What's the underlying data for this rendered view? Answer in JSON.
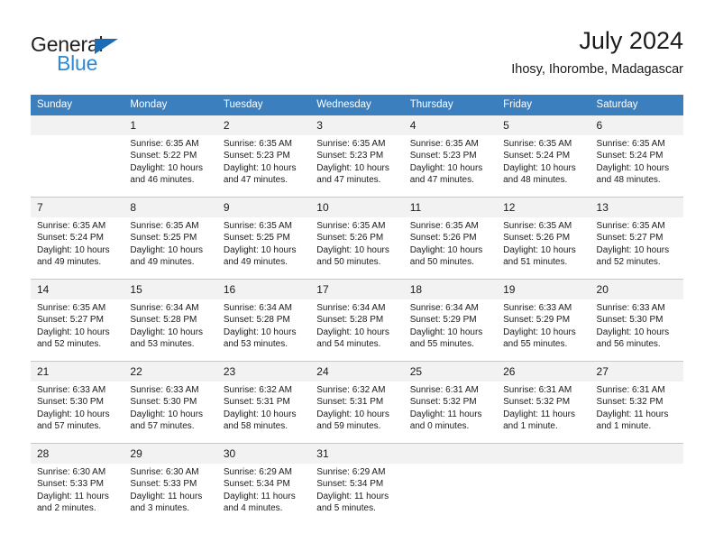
{
  "brand": {
    "name_part1": "General",
    "name_part2": "Blue",
    "accent_color": "#2e8ad4",
    "triangle_color": "#1b6cb5"
  },
  "header": {
    "title": "July 2024",
    "subtitle": "Ihosy, Ihorombe, Madagascar"
  },
  "calendar": {
    "header_color": "#3c7fbe",
    "daynum_band_color": "#f2f2f2",
    "weekday_headers": [
      "Sunday",
      "Monday",
      "Tuesday",
      "Wednesday",
      "Thursday",
      "Friday",
      "Saturday"
    ],
    "weeks": [
      [
        {
          "day": "",
          "sunrise": "",
          "sunset": "",
          "daylight_line1": "",
          "daylight_line2": ""
        },
        {
          "day": "1",
          "sunrise": "Sunrise: 6:35 AM",
          "sunset": "Sunset: 5:22 PM",
          "daylight_line1": "Daylight: 10 hours",
          "daylight_line2": "and 46 minutes."
        },
        {
          "day": "2",
          "sunrise": "Sunrise: 6:35 AM",
          "sunset": "Sunset: 5:23 PM",
          "daylight_line1": "Daylight: 10 hours",
          "daylight_line2": "and 47 minutes."
        },
        {
          "day": "3",
          "sunrise": "Sunrise: 6:35 AM",
          "sunset": "Sunset: 5:23 PM",
          "daylight_line1": "Daylight: 10 hours",
          "daylight_line2": "and 47 minutes."
        },
        {
          "day": "4",
          "sunrise": "Sunrise: 6:35 AM",
          "sunset": "Sunset: 5:23 PM",
          "daylight_line1": "Daylight: 10 hours",
          "daylight_line2": "and 47 minutes."
        },
        {
          "day": "5",
          "sunrise": "Sunrise: 6:35 AM",
          "sunset": "Sunset: 5:24 PM",
          "daylight_line1": "Daylight: 10 hours",
          "daylight_line2": "and 48 minutes."
        },
        {
          "day": "6",
          "sunrise": "Sunrise: 6:35 AM",
          "sunset": "Sunset: 5:24 PM",
          "daylight_line1": "Daylight: 10 hours",
          "daylight_line2": "and 48 minutes."
        }
      ],
      [
        {
          "day": "7",
          "sunrise": "Sunrise: 6:35 AM",
          "sunset": "Sunset: 5:24 PM",
          "daylight_line1": "Daylight: 10 hours",
          "daylight_line2": "and 49 minutes."
        },
        {
          "day": "8",
          "sunrise": "Sunrise: 6:35 AM",
          "sunset": "Sunset: 5:25 PM",
          "daylight_line1": "Daylight: 10 hours",
          "daylight_line2": "and 49 minutes."
        },
        {
          "day": "9",
          "sunrise": "Sunrise: 6:35 AM",
          "sunset": "Sunset: 5:25 PM",
          "daylight_line1": "Daylight: 10 hours",
          "daylight_line2": "and 49 minutes."
        },
        {
          "day": "10",
          "sunrise": "Sunrise: 6:35 AM",
          "sunset": "Sunset: 5:26 PM",
          "daylight_line1": "Daylight: 10 hours",
          "daylight_line2": "and 50 minutes."
        },
        {
          "day": "11",
          "sunrise": "Sunrise: 6:35 AM",
          "sunset": "Sunset: 5:26 PM",
          "daylight_line1": "Daylight: 10 hours",
          "daylight_line2": "and 50 minutes."
        },
        {
          "day": "12",
          "sunrise": "Sunrise: 6:35 AM",
          "sunset": "Sunset: 5:26 PM",
          "daylight_line1": "Daylight: 10 hours",
          "daylight_line2": "and 51 minutes."
        },
        {
          "day": "13",
          "sunrise": "Sunrise: 6:35 AM",
          "sunset": "Sunset: 5:27 PM",
          "daylight_line1": "Daylight: 10 hours",
          "daylight_line2": "and 52 minutes."
        }
      ],
      [
        {
          "day": "14",
          "sunrise": "Sunrise: 6:35 AM",
          "sunset": "Sunset: 5:27 PM",
          "daylight_line1": "Daylight: 10 hours",
          "daylight_line2": "and 52 minutes."
        },
        {
          "day": "15",
          "sunrise": "Sunrise: 6:34 AM",
          "sunset": "Sunset: 5:28 PM",
          "daylight_line1": "Daylight: 10 hours",
          "daylight_line2": "and 53 minutes."
        },
        {
          "day": "16",
          "sunrise": "Sunrise: 6:34 AM",
          "sunset": "Sunset: 5:28 PM",
          "daylight_line1": "Daylight: 10 hours",
          "daylight_line2": "and 53 minutes."
        },
        {
          "day": "17",
          "sunrise": "Sunrise: 6:34 AM",
          "sunset": "Sunset: 5:28 PM",
          "daylight_line1": "Daylight: 10 hours",
          "daylight_line2": "and 54 minutes."
        },
        {
          "day": "18",
          "sunrise": "Sunrise: 6:34 AM",
          "sunset": "Sunset: 5:29 PM",
          "daylight_line1": "Daylight: 10 hours",
          "daylight_line2": "and 55 minutes."
        },
        {
          "day": "19",
          "sunrise": "Sunrise: 6:33 AM",
          "sunset": "Sunset: 5:29 PM",
          "daylight_line1": "Daylight: 10 hours",
          "daylight_line2": "and 55 minutes."
        },
        {
          "day": "20",
          "sunrise": "Sunrise: 6:33 AM",
          "sunset": "Sunset: 5:30 PM",
          "daylight_line1": "Daylight: 10 hours",
          "daylight_line2": "and 56 minutes."
        }
      ],
      [
        {
          "day": "21",
          "sunrise": "Sunrise: 6:33 AM",
          "sunset": "Sunset: 5:30 PM",
          "daylight_line1": "Daylight: 10 hours",
          "daylight_line2": "and 57 minutes."
        },
        {
          "day": "22",
          "sunrise": "Sunrise: 6:33 AM",
          "sunset": "Sunset: 5:30 PM",
          "daylight_line1": "Daylight: 10 hours",
          "daylight_line2": "and 57 minutes."
        },
        {
          "day": "23",
          "sunrise": "Sunrise: 6:32 AM",
          "sunset": "Sunset: 5:31 PM",
          "daylight_line1": "Daylight: 10 hours",
          "daylight_line2": "and 58 minutes."
        },
        {
          "day": "24",
          "sunrise": "Sunrise: 6:32 AM",
          "sunset": "Sunset: 5:31 PM",
          "daylight_line1": "Daylight: 10 hours",
          "daylight_line2": "and 59 minutes."
        },
        {
          "day": "25",
          "sunrise": "Sunrise: 6:31 AM",
          "sunset": "Sunset: 5:32 PM",
          "daylight_line1": "Daylight: 11 hours",
          "daylight_line2": "and 0 minutes."
        },
        {
          "day": "26",
          "sunrise": "Sunrise: 6:31 AM",
          "sunset": "Sunset: 5:32 PM",
          "daylight_line1": "Daylight: 11 hours",
          "daylight_line2": "and 1 minute."
        },
        {
          "day": "27",
          "sunrise": "Sunrise: 6:31 AM",
          "sunset": "Sunset: 5:32 PM",
          "daylight_line1": "Daylight: 11 hours",
          "daylight_line2": "and 1 minute."
        }
      ],
      [
        {
          "day": "28",
          "sunrise": "Sunrise: 6:30 AM",
          "sunset": "Sunset: 5:33 PM",
          "daylight_line1": "Daylight: 11 hours",
          "daylight_line2": "and 2 minutes."
        },
        {
          "day": "29",
          "sunrise": "Sunrise: 6:30 AM",
          "sunset": "Sunset: 5:33 PM",
          "daylight_line1": "Daylight: 11 hours",
          "daylight_line2": "and 3 minutes."
        },
        {
          "day": "30",
          "sunrise": "Sunrise: 6:29 AM",
          "sunset": "Sunset: 5:34 PM",
          "daylight_line1": "Daylight: 11 hours",
          "daylight_line2": "and 4 minutes."
        },
        {
          "day": "31",
          "sunrise": "Sunrise: 6:29 AM",
          "sunset": "Sunset: 5:34 PM",
          "daylight_line1": "Daylight: 11 hours",
          "daylight_line2": "and 5 minutes."
        },
        {
          "day": "",
          "sunrise": "",
          "sunset": "",
          "daylight_line1": "",
          "daylight_line2": ""
        },
        {
          "day": "",
          "sunrise": "",
          "sunset": "",
          "daylight_line1": "",
          "daylight_line2": ""
        },
        {
          "day": "",
          "sunrise": "",
          "sunset": "",
          "daylight_line1": "",
          "daylight_line2": ""
        }
      ]
    ]
  }
}
